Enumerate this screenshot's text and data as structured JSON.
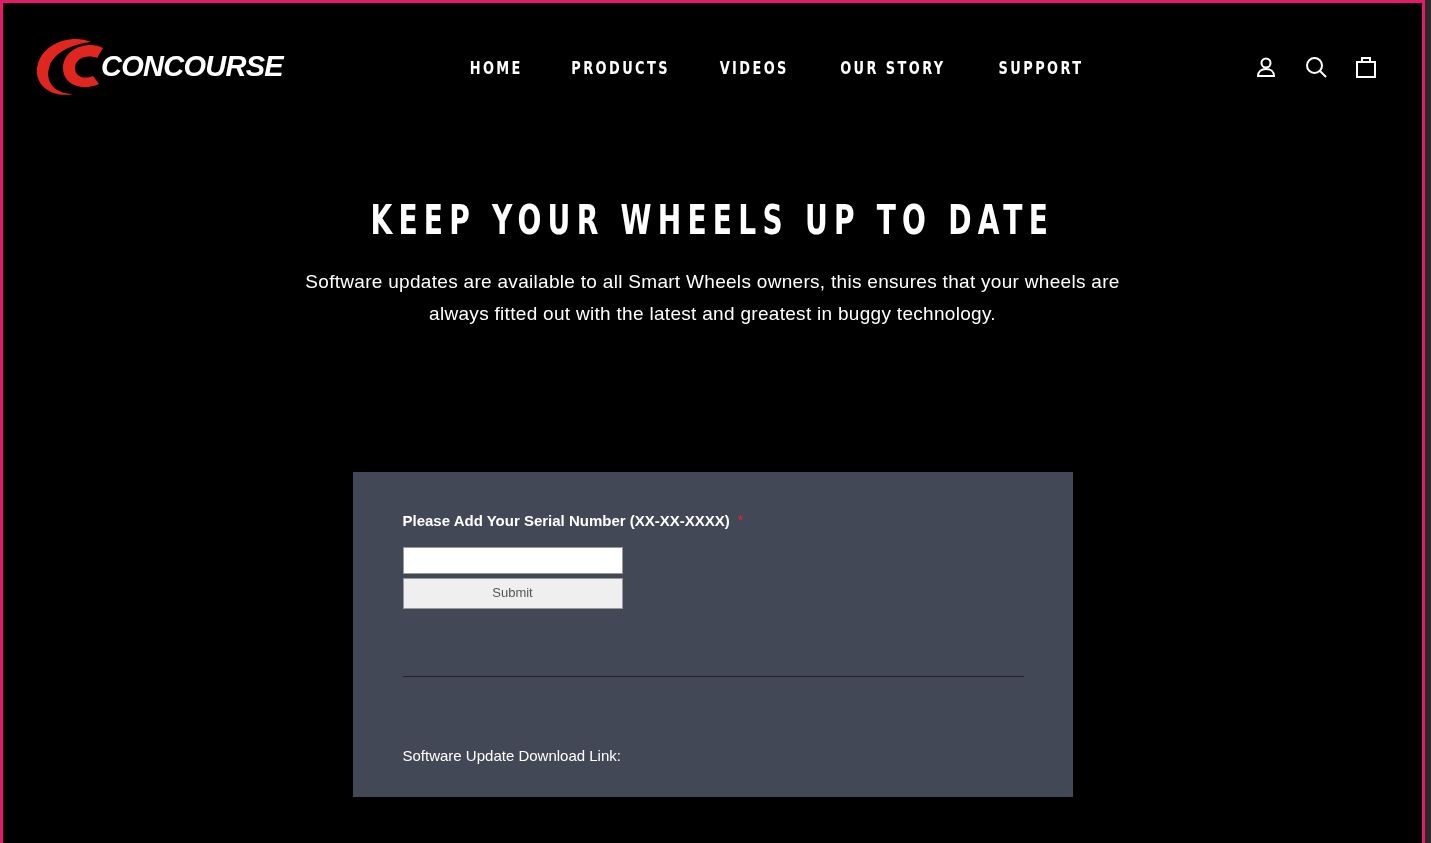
{
  "header": {
    "logo_text": "CONCOURSE",
    "nav": [
      "HOME",
      "PRODUCTS",
      "VIDEOS",
      "OUR STORY",
      "SUPPORT"
    ]
  },
  "hero": {
    "title": "KEEP YOUR WHEELS UP TO DATE",
    "text": "Software updates are available to all Smart Wheels owners, this ensures that your wheels are always fitted out with the latest and greatest in buggy technology."
  },
  "form": {
    "label": "Please Add Your Serial Number (XX-XX-XXXX)",
    "required_mark": "*",
    "submit": "Submit",
    "download_label": "Software Update Download Link:"
  }
}
